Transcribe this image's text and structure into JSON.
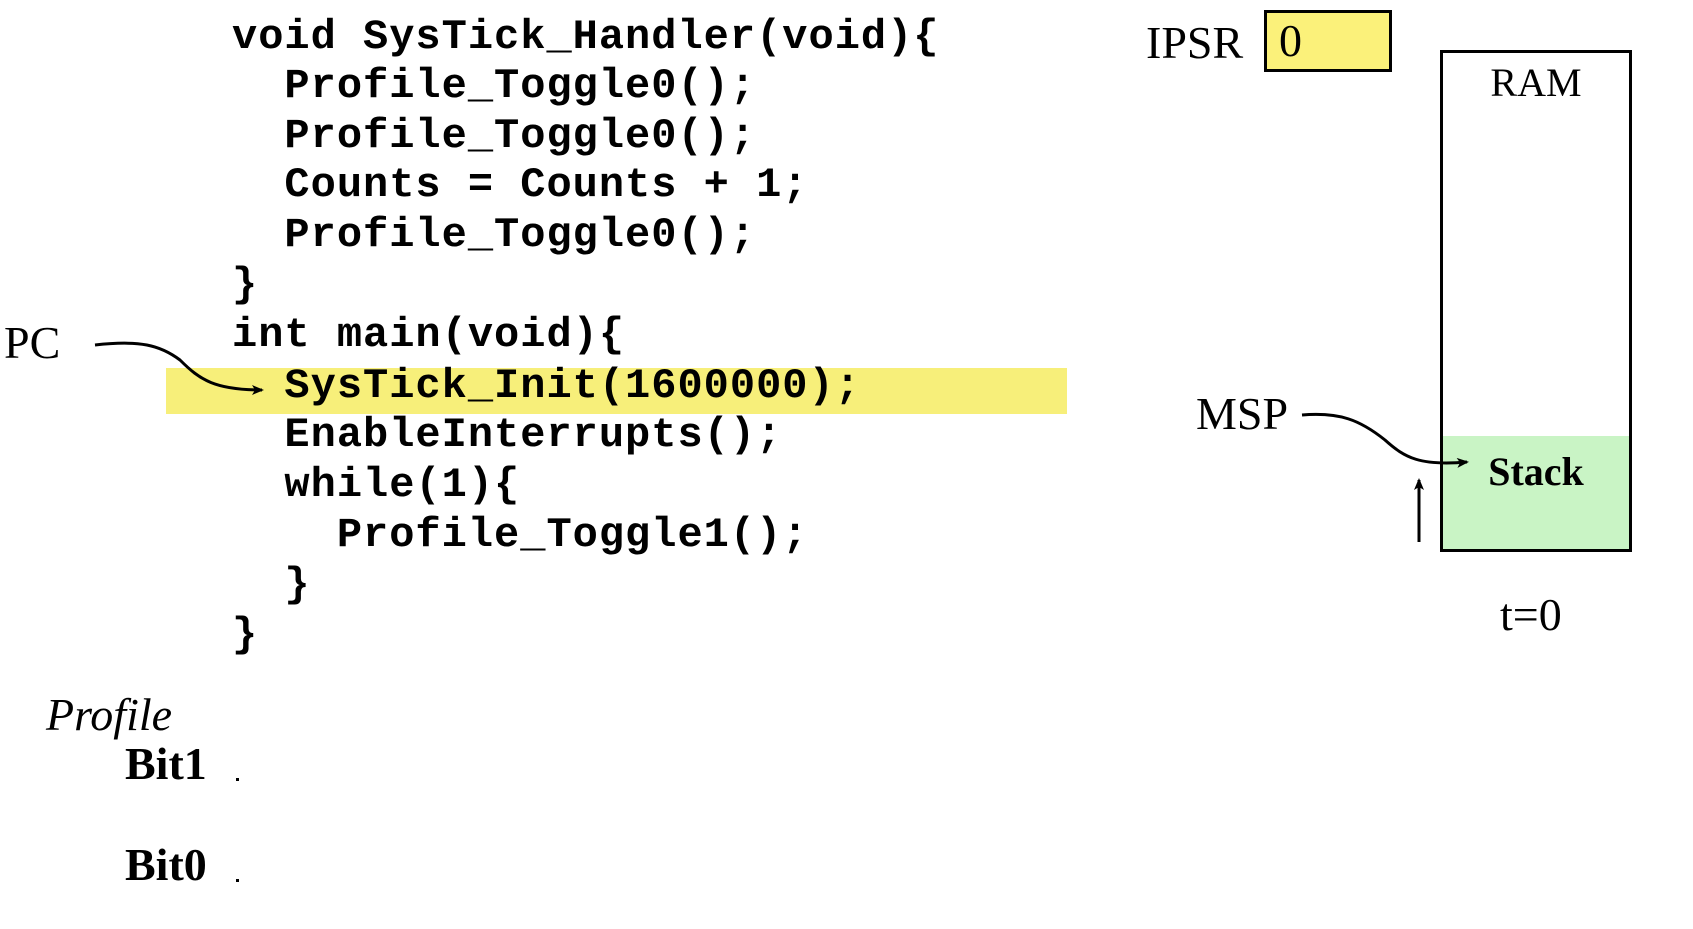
{
  "code": {
    "lines": [
      "void SysTick_Handler(void){",
      "  Profile_Toggle0();",
      "  Profile_Toggle0();",
      "  Counts = Counts + 1;",
      "  Profile_Toggle0();",
      "}",
      "int main(void){",
      "  SysTick_Init(1600000);",
      "  EnableInterrupts();",
      "  while(1){",
      "    Profile_Toggle1();",
      "  }",
      "}"
    ],
    "highlighted_line_index": 7,
    "highlight_color": "#f7ef7a"
  },
  "labels": {
    "pc": "PC",
    "msp": "MSP",
    "ipsr": "IPSR",
    "ipsr_value": "0",
    "ram": "RAM",
    "stack": "Stack",
    "time": "t=0",
    "profile": "Profile",
    "bit1": "Bit1",
    "bit0": "Bit0"
  },
  "colors": {
    "ipsr_fill": "#fbf17a",
    "stack_fill": "#c9f4c5"
  },
  "icons": {
    "pc_pointer": "arrow-right-curved",
    "msp_pointer": "arrow-right-curved",
    "stack_growth": "arrow-up"
  }
}
